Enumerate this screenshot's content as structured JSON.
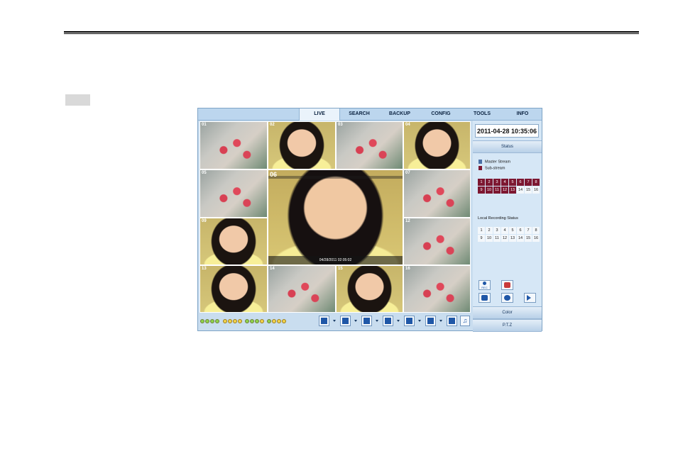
{
  "tabs": [
    {
      "label": "LIVE",
      "active": true
    },
    {
      "label": "SEARCH",
      "active": false
    },
    {
      "label": "BACKUP",
      "active": false
    },
    {
      "label": "CONFIG",
      "active": false
    },
    {
      "label": "TOOLS",
      "active": false
    },
    {
      "label": "INFO",
      "active": false
    }
  ],
  "clock": "2011-04-28 10:35:06",
  "status_header": "Status",
  "legend": {
    "master": "Master Stream",
    "sub": "Sub-stream",
    "master_color": "#4a6fa5",
    "sub_color": "#7d1731"
  },
  "stream_channels": [
    "1",
    "2",
    "3",
    "4",
    "5",
    "6",
    "7",
    "8",
    "9",
    "10",
    "11",
    "12",
    "13",
    "14",
    "15",
    "16"
  ],
  "stream_sub_count": 13,
  "local_recording_label": "Local Recording Status",
  "rec_channels": [
    "1",
    "2",
    "3",
    "4",
    "5",
    "6",
    "7",
    "8",
    "9",
    "10",
    "11",
    "12",
    "13",
    "14",
    "15",
    "16"
  ],
  "big_tile": {
    "channel": "06",
    "timestamp": "04/28/2011 02:05:02"
  },
  "color_header": "Color",
  "ptz_header": "P.T.Z",
  "rec_button_label": "REC"
}
